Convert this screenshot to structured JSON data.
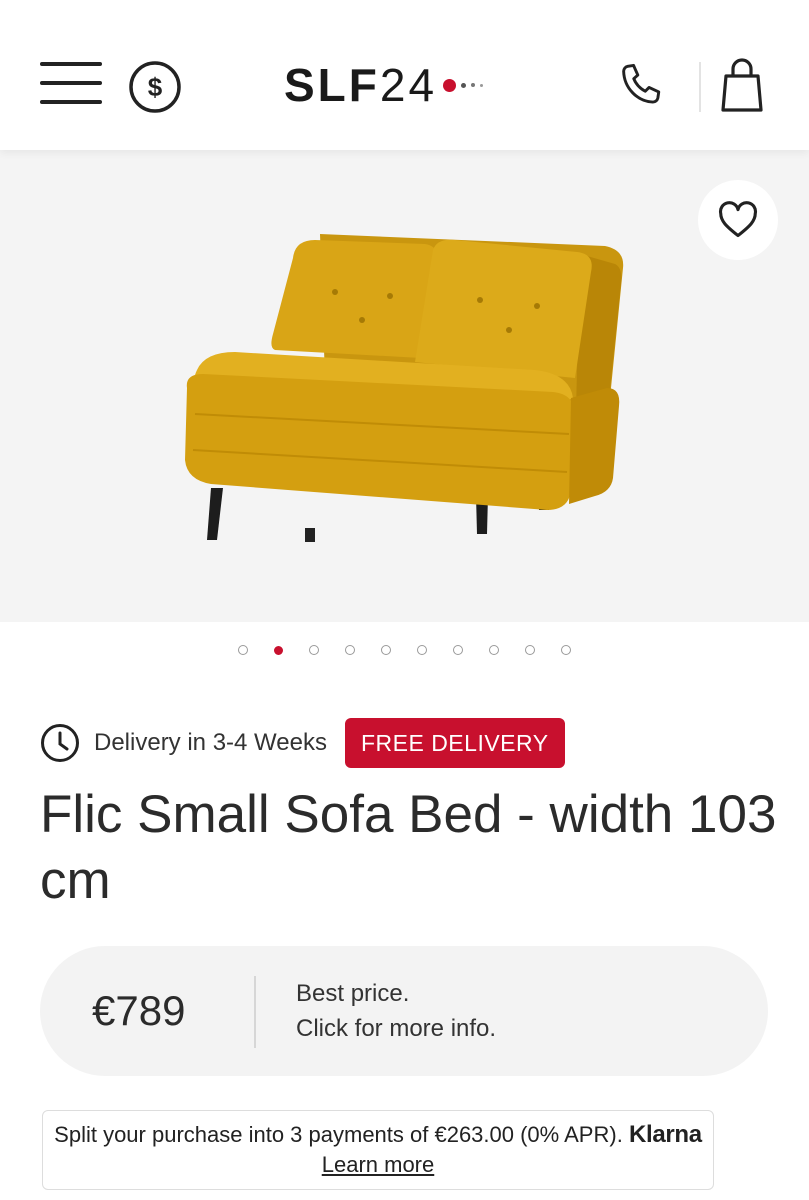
{
  "header": {
    "logo_text": "SLF24",
    "menu_icon": "hamburger-icon",
    "currency_icon": "dollar-circle-icon",
    "phone_icon": "phone-icon",
    "bag_icon": "shopping-bag-icon",
    "accent_color": "#c8102e"
  },
  "gallery": {
    "wishlist_icon": "heart-icon",
    "image_alt": "sofa-image",
    "dot_count": 10,
    "active_dot": 1
  },
  "product": {
    "delivery_icon": "clock-icon",
    "delivery_text": "Delivery in 3-4 Weeks",
    "badge": "FREE DELIVERY",
    "title": "Flic Small Sofa Bed - width 103 cm"
  },
  "price_card": {
    "price": "€789",
    "info_line1": "Best price.",
    "info_line2": "Click for more info."
  },
  "klarna": {
    "text": "Split your purchase into 3 payments of €263.00 (0% APR).",
    "logo": "Klarna",
    "link": "Learn more"
  }
}
